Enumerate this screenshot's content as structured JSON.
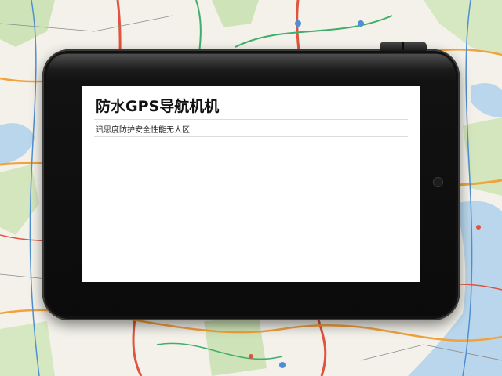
{
  "device": {
    "screen": {
      "title": "防水GPS导航机机",
      "subtitle": "讯思度防护安全性能无人区"
    }
  },
  "background": {
    "map_colors": {
      "land": "#f3f1ea",
      "park": "#cfe3b8",
      "water": "#b9d6ec",
      "highway_orange": "#f2a23a",
      "highway_red": "#e0533d",
      "road_green": "#3fae6a",
      "road_blue": "#4f8fd1"
    }
  }
}
